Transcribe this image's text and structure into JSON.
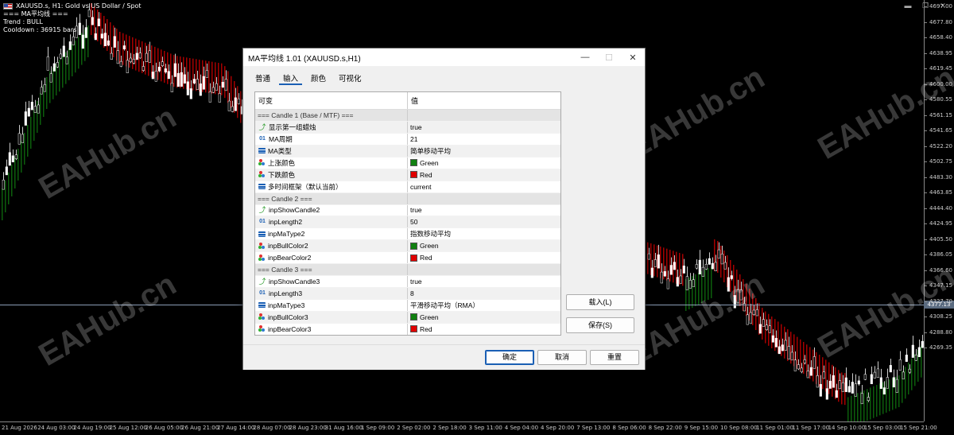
{
  "chart": {
    "header_line1": "XAUUSD.s, H1:  Gold vs US Dollar / Spot",
    "header_line2": "=== MA平均线 ===",
    "header_line3": "Trend : BULL",
    "header_line4": "Cooldown : 36915 bars",
    "current_price": "4377.13",
    "price_labels": [
      "4697.00",
      "4677.80",
      "4658.40",
      "4638.95",
      "4619.45",
      "4600.00",
      "4580.55",
      "4561.15",
      "4541.65",
      "4522.20",
      "4502.75",
      "4483.30",
      "4463.85",
      "4444.40",
      "4424.95",
      "4405.50",
      "4386.05",
      "4366.60",
      "4347.15",
      "4327.70",
      "4308.25",
      "4288.80",
      "4269.35"
    ],
    "time_labels": [
      "21 Aug 2026",
      "24 Aug 03:00",
      "24 Aug 19:00",
      "25 Aug 12:00",
      "26 Aug 05:00",
      "26 Aug 21:00",
      "27 Aug 14:00",
      "28 Aug 07:00",
      "28 Aug 23:00",
      "31 Aug 16:00",
      "1 Sep 09:00",
      "2 Sep 02:00",
      "2 Sep 18:00",
      "3 Sep 11:00",
      "4 Sep 04:00",
      "4 Sep 20:00",
      "7 Sep 13:00",
      "8 Sep 06:00",
      "8 Sep 22:00",
      "9 Sep 15:00",
      "10 Sep 08:00",
      "11 Sep 01:00",
      "11 Sep 17:00",
      "14 Sep 10:00",
      "15 Sep 03:00",
      "15 Sep 21:00"
    ],
    "watermark_text": "EAHub.cn",
    "colors": {
      "bull": "#1f9a1f",
      "bear": "#e01010",
      "ma_bull": "#0e6e0e",
      "ma_bear": "#c40000"
    }
  },
  "dialog": {
    "title": "MA平均线 1.01 (XAUUSD.s,H1)",
    "tabs": [
      "普通",
      "输入",
      "颜色",
      "可视化"
    ],
    "active_tab": 1,
    "col_variable": "可变",
    "col_value": "值",
    "rows": [
      {
        "type": "section",
        "name": "=== Candle 1 (Base / MTF) ===",
        "value": ""
      },
      {
        "type": "bool",
        "name": "显示第一组蜡烛",
        "value": "true"
      },
      {
        "type": "int",
        "name": "MA周期",
        "value": "21"
      },
      {
        "type": "enum",
        "name": "MA类型",
        "value": "简单移动平均"
      },
      {
        "type": "color",
        "name": "上涨颜色",
        "value": "Green",
        "swatch": "#108010"
      },
      {
        "type": "color",
        "name": "下跌颜色",
        "value": "Red",
        "swatch": "#e00000"
      },
      {
        "type": "enum",
        "name": "多时间框架（默认当前）",
        "value": "current"
      },
      {
        "type": "section",
        "name": "=== Candle 2 ===",
        "value": ""
      },
      {
        "type": "bool",
        "name": "inpShowCandle2",
        "value": "true"
      },
      {
        "type": "int",
        "name": "inpLength2",
        "value": "50"
      },
      {
        "type": "enum",
        "name": "inpMaType2",
        "value": "指数移动平均"
      },
      {
        "type": "color",
        "name": "inpBullColor2",
        "value": "Green",
        "swatch": "#108010"
      },
      {
        "type": "color",
        "name": "inpBearColor2",
        "value": "Red",
        "swatch": "#e00000"
      },
      {
        "type": "section",
        "name": "=== Candle 3 ===",
        "value": ""
      },
      {
        "type": "bool",
        "name": "inpShowCandle3",
        "value": "true"
      },
      {
        "type": "int",
        "name": "inpLength3",
        "value": "8"
      },
      {
        "type": "enum",
        "name": "inpMaType3",
        "value": "平滑移动平均（RMA）"
      },
      {
        "type": "color",
        "name": "inpBullColor3",
        "value": "Green",
        "swatch": "#108010"
      },
      {
        "type": "color",
        "name": "inpBearColor3",
        "value": "Red",
        "swatch": "#e00000"
      }
    ],
    "load_label": "载入(L)",
    "save_label": "保存(S)",
    "ok_label": "确定",
    "cancel_label": "取消",
    "reset_label": "重置"
  }
}
